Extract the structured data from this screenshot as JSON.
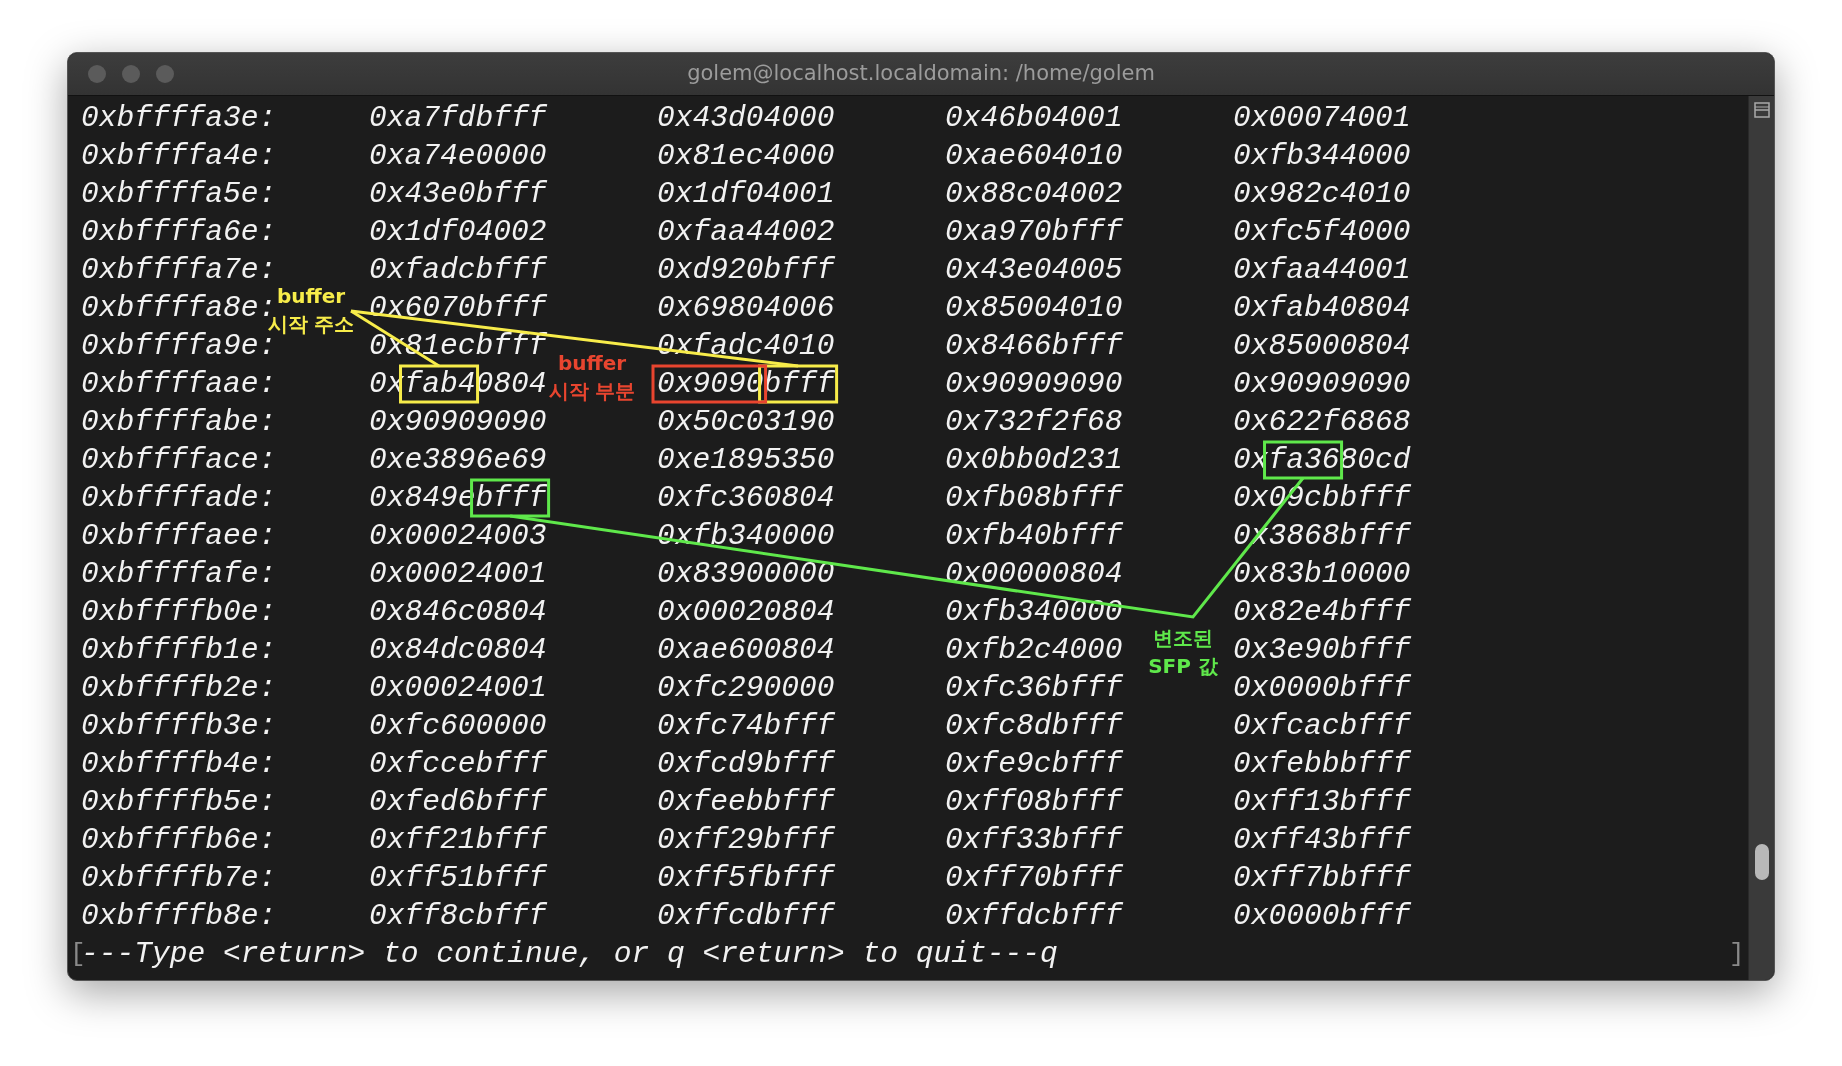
{
  "window": {
    "title": "golem@localhost.localdomain: /home/golem"
  },
  "rows": [
    {
      "address": "0xbffffa3e:",
      "words": [
        "0xa7fdbfff",
        "0x43d04000",
        "0x46b04001",
        "0x00074001"
      ]
    },
    {
      "address": "0xbffffa4e:",
      "words": [
        "0xa74e0000",
        "0x81ec4000",
        "0xae604010",
        "0xfb344000"
      ]
    },
    {
      "address": "0xbffffa5e:",
      "words": [
        "0x43e0bfff",
        "0x1df04001",
        "0x88c04002",
        "0x982c4010"
      ]
    },
    {
      "address": "0xbffffa6e:",
      "words": [
        "0x1df04002",
        "0xfaa44002",
        "0xa970bfff",
        "0xfc5f4000"
      ]
    },
    {
      "address": "0xbffffa7e:",
      "words": [
        "0xfadcbfff",
        "0xd920bfff",
        "0x43e04005",
        "0xfaa44001"
      ]
    },
    {
      "address": "0xbffffa8e:",
      "words": [
        "0x6070bfff",
        "0x69804006",
        "0x85004010",
        "0xfab40804"
      ]
    },
    {
      "address": "0xbffffa9e:",
      "words": [
        "0x81ecbfff",
        "0xfadc4010",
        "0x8466bfff",
        "0x85000804"
      ]
    },
    {
      "address": "0xbffffaae:",
      "words": [
        "0xfab40804",
        "0x9090bfff",
        "0x90909090",
        "0x90909090"
      ]
    },
    {
      "address": "0xbffffabe:",
      "words": [
        "0x90909090",
        "0x50c03190",
        "0x732f2f68",
        "0x622f6868"
      ]
    },
    {
      "address": "0xbfffface:",
      "words": [
        "0xe3896e69",
        "0xe1895350",
        "0x0bb0d231",
        "0xfa3680cd"
      ]
    },
    {
      "address": "0xbffffade:",
      "words": [
        "0x849ebfff",
        "0xfc360804",
        "0xfb08bfff",
        "0x09cbbfff"
      ]
    },
    {
      "address": "0xbffffaee:",
      "words": [
        "0x00024003",
        "0xfb340000",
        "0xfb40bfff",
        "0x3868bfff"
      ]
    },
    {
      "address": "0xbffffafe:",
      "words": [
        "0x00024001",
        "0x83900000",
        "0x00000804",
        "0x83b10000"
      ]
    },
    {
      "address": "0xbffffb0e:",
      "words": [
        "0x846c0804",
        "0x00020804",
        "0xfb340000",
        "0x82e4bfff"
      ]
    },
    {
      "address": "0xbffffb1e:",
      "words": [
        "0x84dc0804",
        "0xae600804",
        "0xfb2c4000",
        "0x3e90bfff"
      ]
    },
    {
      "address": "0xbffffb2e:",
      "words": [
        "0x00024001",
        "0xfc290000",
        "0xfc36bfff",
        "0x0000bfff"
      ]
    },
    {
      "address": "0xbffffb3e:",
      "words": [
        "0xfc600000",
        "0xfc74bfff",
        "0xfc8dbfff",
        "0xfcacbfff"
      ]
    },
    {
      "address": "0xbffffb4e:",
      "words": [
        "0xfccebfff",
        "0xfcd9bfff",
        "0xfe9cbfff",
        "0xfebbbfff"
      ]
    },
    {
      "address": "0xbffffb5e:",
      "words": [
        "0xfed6bfff",
        "0xfeebbfff",
        "0xff08bfff",
        "0xff13bfff"
      ]
    },
    {
      "address": "0xbffffb6e:",
      "words": [
        "0xff21bfff",
        "0xff29bfff",
        "0xff33bfff",
        "0xff43bfff"
      ]
    },
    {
      "address": "0xbffffb7e:",
      "words": [
        "0xff51bfff",
        "0xff5fbfff",
        "0xff70bfff",
        "0xff7bbfff"
      ]
    },
    {
      "address": "0xbffffb8e:",
      "words": [
        "0xff8cbfff",
        "0xffcdbfff",
        "0xffdcbfff",
        "0x0000bfff"
      ]
    }
  ],
  "prompt": {
    "left": "[",
    "text": "---Type <return> to continue, or q <return> to quit---q",
    "right": "]"
  },
  "annotations": [
    {
      "color": "#f7ec4a",
      "label": "buffer\n시작 주소"
    },
    {
      "color": "#e8452f",
      "label": "buffer\n시작 부분"
    },
    {
      "color": "#5fe84b",
      "label": "변조된\nSFP 값"
    }
  ]
}
